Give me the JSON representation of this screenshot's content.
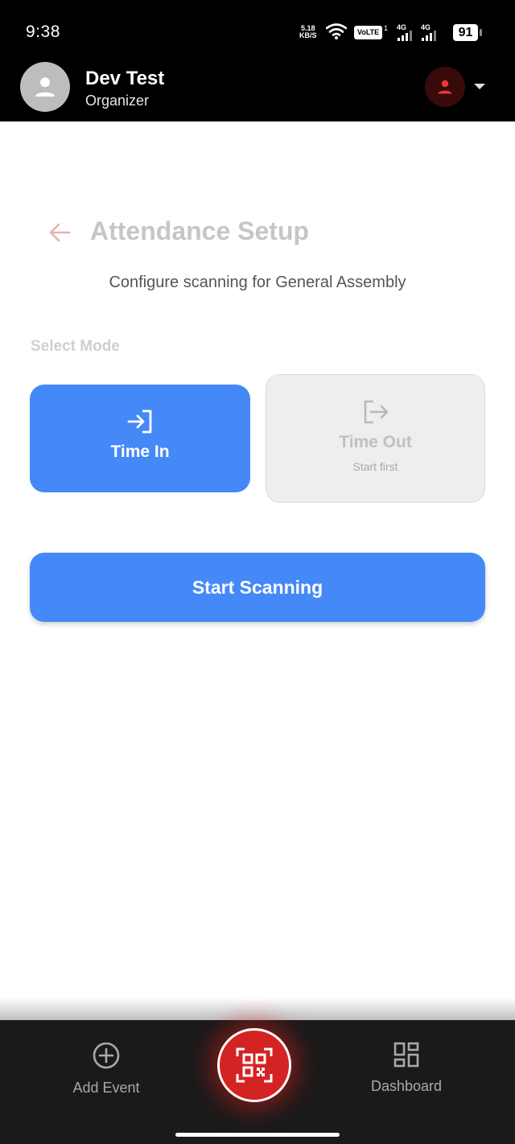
{
  "status_bar": {
    "time": "9:38",
    "net_speed_value": "5.18",
    "net_speed_unit": "KB/S",
    "volte": "VoLTE",
    "volte_sup": "1",
    "sim1": "4G",
    "sim2": "4G",
    "battery": "91"
  },
  "header": {
    "user_name": "Dev Test",
    "user_role": "Organizer"
  },
  "page": {
    "title": "Attendance Setup",
    "subtitle": "Configure scanning for General Assembly",
    "mode_label": "Select Mode"
  },
  "modes": {
    "time_in": {
      "label": "Time In"
    },
    "time_out": {
      "label": "Time Out",
      "hint": "Start first"
    }
  },
  "actions": {
    "start_label": "Start Scanning"
  },
  "bottom_nav": {
    "add_event": "Add Event",
    "dashboard": "Dashboard"
  },
  "colors": {
    "accent_blue": "#4589f8",
    "scan_red": "#d42323",
    "header_bg": "#000000",
    "nav_bg": "#1a1a1a"
  }
}
